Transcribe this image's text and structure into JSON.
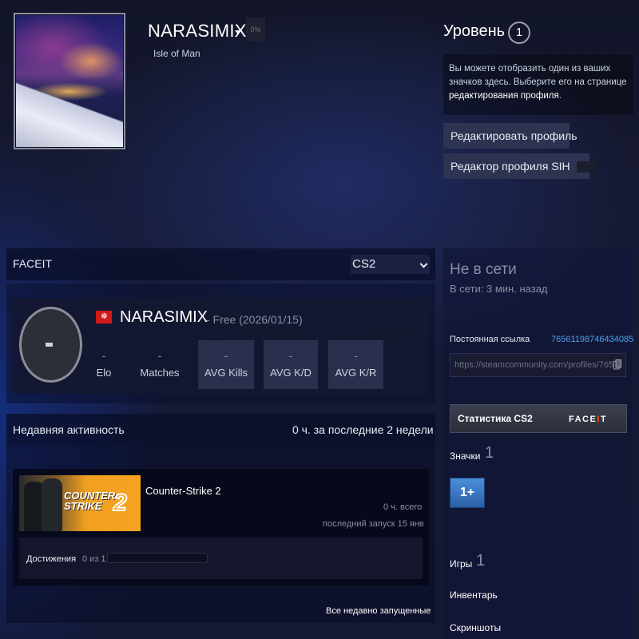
{
  "header": {
    "persona_name": "NARASIMIX",
    "persona_pct": "0%",
    "location": "Isle of Man",
    "level_label": "Уровень",
    "level_value": "1",
    "badge_hint_text": "Вы можете отобразить один из ваших значков здесь. Выберите его на странице ",
    "badge_hint_link": "редактирования профиля",
    "badge_hint_end": ".",
    "edit_profile_button": "Редактировать профиль",
    "sih_editor_button": "Редактор профиля SIH"
  },
  "faceit": {
    "section_title": "FACEIT",
    "game_select": "CS2",
    "level_mark": "-",
    "nickname": "NARASIMIX",
    "subscription": "- Free (2026/01/15)",
    "flag_icon": "isle-of-man-flag-icon",
    "stats": [
      {
        "value": "-",
        "label": "Elo"
      },
      {
        "value": "-",
        "label": "Matches"
      },
      {
        "value": "-",
        "label": "AVG Kills"
      },
      {
        "value": "-",
        "label": "AVG K/D"
      },
      {
        "value": "-",
        "label": "AVG K/R"
      }
    ]
  },
  "recent": {
    "title": "Недавняя активность",
    "hours_summary": "0 ч. за последние 2 недели",
    "game": {
      "capsule_text": "COUNTER STRIKE",
      "capsule_number": "2",
      "name": "Counter-Strike 2",
      "hours_total": "0 ч. всего",
      "last_played": "последний запуск 15 янв",
      "achievements_label": "Достижения",
      "achievements_count": "0 из 1",
      "achievements_progress": 0
    },
    "all_recent_link": "Все недавно запущенные"
  },
  "sidebar": {
    "status": "Не в сети",
    "last_online": "В сети: 3 мин. назад",
    "permalink_label": "Постоянная ссылка",
    "permalink_id": "76561198746434085",
    "permalink_url": "https://steamcommunity.com/profiles/765",
    "stats_button": "Статистика CS2",
    "stats_logo_a": "FACE",
    "stats_logo_b": "I",
    "stats_logo_c": "T",
    "badges_label": "Значки",
    "badges_count": "1",
    "badge_tile": "1+",
    "games_label": "Игры",
    "games_count": "1",
    "inventory_label": "Инвентарь",
    "screenshots_label": "Скриншоты"
  },
  "colors": {
    "accent_link": "#4aa3f0",
    "faceit_orange": "#ff5500",
    "button_bg": "#2e3352"
  }
}
